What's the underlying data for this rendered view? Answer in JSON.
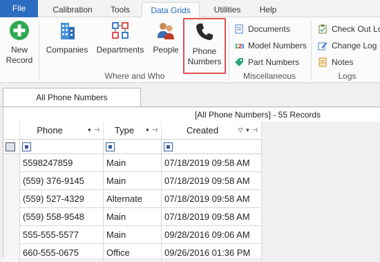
{
  "ribbon_tabs": [
    {
      "label": "File"
    },
    {
      "label": "Calibration"
    },
    {
      "label": "Tools"
    },
    {
      "label": "Data Grids"
    },
    {
      "label": "Utilities"
    },
    {
      "label": "Help"
    }
  ],
  "ribbon": {
    "new_record": {
      "line1": "New",
      "line2": "Record"
    },
    "companies": "Companies",
    "departments": "Departments",
    "people": "People",
    "phone_numbers": {
      "line1": "Phone",
      "line2": "Numbers"
    },
    "group_where_who": "Where and Who",
    "misc": {
      "documents": "Documents",
      "model_numbers": "Model Numbers",
      "part_numbers": "Part Numbers",
      "label": "Miscellaneous"
    },
    "logs": {
      "check_out_log": "Check Out Lo",
      "change_log": "Change Log",
      "notes": "Notes",
      "label": "Logs"
    },
    "colors": {
      "accent": "#2b6cc0",
      "highlight_border": "#e25050"
    }
  },
  "document": {
    "tab_label": "All Phone Numbers",
    "caption": "[All Phone Numbers] - 55 Records"
  },
  "grid": {
    "columns": [
      {
        "label": "Phone",
        "controls": "▾ ⊣"
      },
      {
        "label": "Type",
        "controls": "▾ ⊣"
      },
      {
        "label": "Created",
        "controls": "▽ ▾ ⊣"
      }
    ],
    "rows": [
      {
        "phone": "5598247859",
        "type": "Main",
        "created": "07/18/2019 09:58 AM"
      },
      {
        "phone": "(559) 376-9145",
        "type": "Main",
        "created": "07/18/2019 09:58 AM"
      },
      {
        "phone": "(559) 527-4329",
        "type": "Alternate",
        "created": "07/18/2019 09:58 AM"
      },
      {
        "phone": "(559) 558-9548",
        "type": "Main",
        "created": "07/18/2019 09:58 AM"
      },
      {
        "phone": "555-555-5577",
        "type": "Main",
        "created": "09/28/2016 09:06 AM"
      },
      {
        "phone": "660-555-0675",
        "type": "Office",
        "created": "09/26/2016 01:36 PM"
      }
    ]
  }
}
